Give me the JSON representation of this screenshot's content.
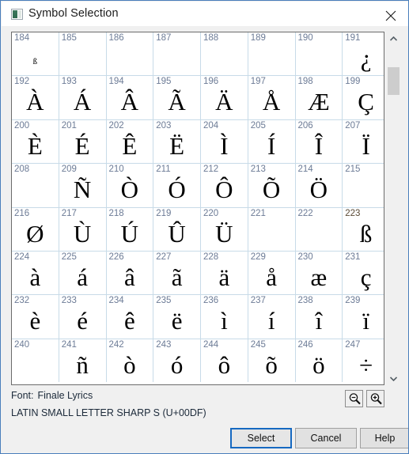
{
  "window": {
    "title": "Symbol Selection",
    "icon": "symbol-window-icon",
    "close_icon": "close-icon"
  },
  "grid": {
    "columns": 8,
    "selected_code": 223,
    "rows": [
      [
        {
          "code": "184",
          "glyph": "ß",
          "tiny": true,
          "selected": false
        },
        {
          "code": "185",
          "glyph": "",
          "selected": false
        },
        {
          "code": "186",
          "glyph": "",
          "selected": false
        },
        {
          "code": "187",
          "glyph": "",
          "selected": false
        },
        {
          "code": "188",
          "glyph": "",
          "selected": false
        },
        {
          "code": "189",
          "glyph": "",
          "selected": false
        },
        {
          "code": "190",
          "glyph": "",
          "selected": false
        },
        {
          "code": "191",
          "glyph": "¿",
          "selected": false
        }
      ],
      [
        {
          "code": "192",
          "glyph": "À",
          "selected": false
        },
        {
          "code": "193",
          "glyph": "Á",
          "selected": false
        },
        {
          "code": "194",
          "glyph": "Â",
          "selected": false
        },
        {
          "code": "195",
          "glyph": "Ã",
          "selected": false
        },
        {
          "code": "196",
          "glyph": "Ä",
          "selected": false
        },
        {
          "code": "197",
          "glyph": "Å",
          "selected": false
        },
        {
          "code": "198",
          "glyph": "Æ",
          "selected": false
        },
        {
          "code": "199",
          "glyph": "Ç",
          "selected": false
        }
      ],
      [
        {
          "code": "200",
          "glyph": "È",
          "selected": false
        },
        {
          "code": "201",
          "glyph": "É",
          "selected": false
        },
        {
          "code": "202",
          "glyph": "Ê",
          "selected": false
        },
        {
          "code": "203",
          "glyph": "Ë",
          "selected": false
        },
        {
          "code": "204",
          "glyph": "Ì",
          "selected": false
        },
        {
          "code": "205",
          "glyph": "Í",
          "selected": false
        },
        {
          "code": "206",
          "glyph": "Î",
          "selected": false
        },
        {
          "code": "207",
          "glyph": "Ï",
          "selected": false
        }
      ],
      [
        {
          "code": "208",
          "glyph": "",
          "selected": false
        },
        {
          "code": "209",
          "glyph": "Ñ",
          "selected": false
        },
        {
          "code": "210",
          "glyph": "Ò",
          "selected": false
        },
        {
          "code": "211",
          "glyph": "Ó",
          "selected": false
        },
        {
          "code": "212",
          "glyph": "Ô",
          "selected": false
        },
        {
          "code": "213",
          "glyph": "Õ",
          "selected": false
        },
        {
          "code": "214",
          "glyph": "Ö",
          "selected": false
        },
        {
          "code": "215",
          "glyph": "",
          "selected": false
        }
      ],
      [
        {
          "code": "216",
          "glyph": "Ø",
          "selected": false
        },
        {
          "code": "217",
          "glyph": "Ù",
          "selected": false
        },
        {
          "code": "218",
          "glyph": "Ú",
          "selected": false
        },
        {
          "code": "219",
          "glyph": "Û",
          "selected": false
        },
        {
          "code": "220",
          "glyph": "Ü",
          "selected": false
        },
        {
          "code": "221",
          "glyph": "",
          "selected": false
        },
        {
          "code": "222",
          "glyph": "",
          "selected": false
        },
        {
          "code": "223",
          "glyph": "ß",
          "selected": true
        }
      ],
      [
        {
          "code": "224",
          "glyph": "à",
          "selected": false
        },
        {
          "code": "225",
          "glyph": "á",
          "selected": false
        },
        {
          "code": "226",
          "glyph": "â",
          "selected": false
        },
        {
          "code": "227",
          "glyph": "ã",
          "selected": false
        },
        {
          "code": "228",
          "glyph": "ä",
          "selected": false
        },
        {
          "code": "229",
          "glyph": "å",
          "selected": false
        },
        {
          "code": "230",
          "glyph": "æ",
          "selected": false
        },
        {
          "code": "231",
          "glyph": "ç",
          "selected": false
        }
      ],
      [
        {
          "code": "232",
          "glyph": "è",
          "selected": false
        },
        {
          "code": "233",
          "glyph": "é",
          "selected": false
        },
        {
          "code": "234",
          "glyph": "ê",
          "selected": false
        },
        {
          "code": "235",
          "glyph": "ë",
          "selected": false
        },
        {
          "code": "236",
          "glyph": "ì",
          "selected": false
        },
        {
          "code": "237",
          "glyph": "í",
          "selected": false
        },
        {
          "code": "238",
          "glyph": "î",
          "selected": false
        },
        {
          "code": "239",
          "glyph": "ï",
          "selected": false
        }
      ],
      [
        {
          "code": "240",
          "glyph": "",
          "selected": false
        },
        {
          "code": "241",
          "glyph": "ñ",
          "selected": false
        },
        {
          "code": "242",
          "glyph": "ò",
          "selected": false
        },
        {
          "code": "243",
          "glyph": "ó",
          "selected": false
        },
        {
          "code": "244",
          "glyph": "ô",
          "selected": false
        },
        {
          "code": "245",
          "glyph": "õ",
          "selected": false
        },
        {
          "code": "246",
          "glyph": "ö",
          "selected": false
        },
        {
          "code": "247",
          "glyph": "÷",
          "selected": false
        }
      ]
    ]
  },
  "scrollbar": {
    "up_icon": "chevron-up-icon",
    "down_icon": "chevron-down-icon"
  },
  "status": {
    "font_label": "Font:",
    "font_value": "Finale Lyrics",
    "character_name": "LATIN SMALL LETTER SHARP S (U+00DF)",
    "zoom_out_icon": "zoom-out-icon",
    "zoom_in_icon": "zoom-in-icon"
  },
  "buttons": {
    "select": "Select",
    "cancel": "Cancel",
    "help": "Help"
  },
  "colors": {
    "window_border": "#4a7ebb",
    "grid_line": "#c8dbe8",
    "index_text": "#6c7b96",
    "selection_bg": "#000000",
    "default_button_focus": "#1669c1",
    "dialog_bg": "#f0f0f0"
  }
}
